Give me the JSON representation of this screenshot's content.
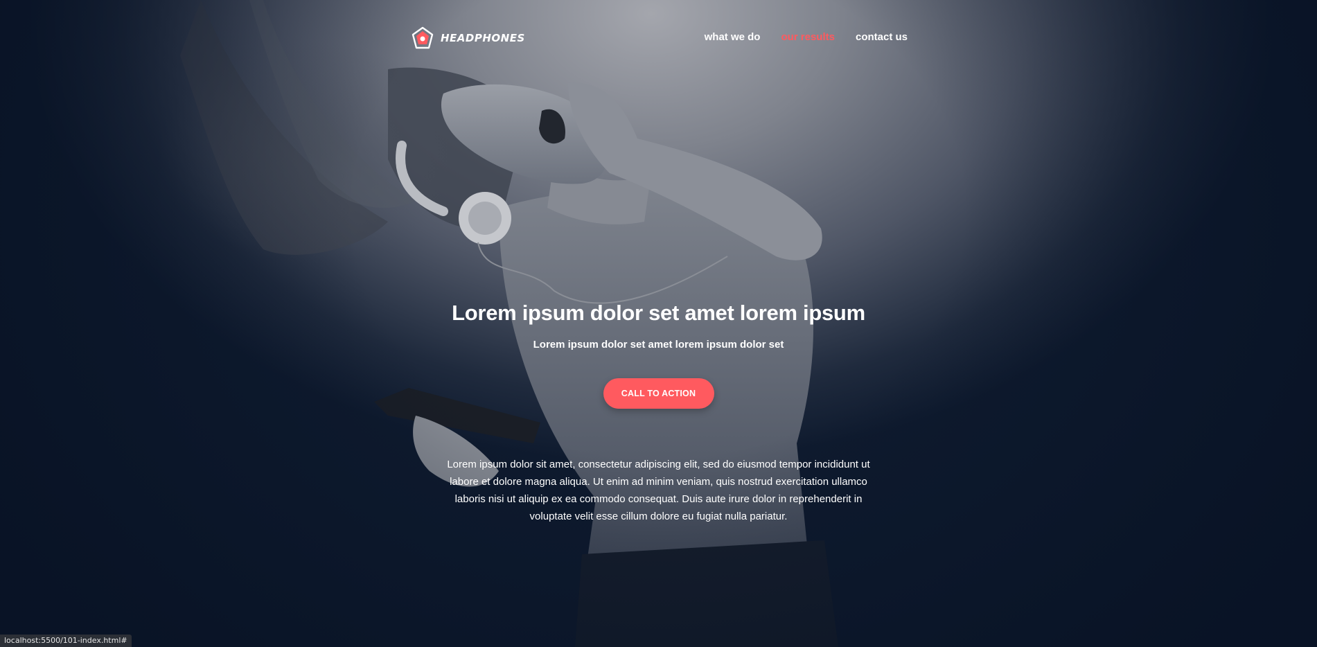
{
  "brand": {
    "name": "HEADPHONES",
    "logo_icon": "pentagon-logo-icon",
    "accent_color": "#ff5a5f"
  },
  "nav": {
    "items": [
      {
        "label": "what we do",
        "active": false
      },
      {
        "label": "our results",
        "active": true
      },
      {
        "label": "contact us",
        "active": false
      }
    ]
  },
  "hero": {
    "title": "Lorem ipsum dolor set amet lorem ipsum",
    "subtitle": "Lorem ipsum dolor set amet lorem ipsum dolor set",
    "cta_label": "CALL TO ACTION",
    "body": "Lorem ipsum dolor sit amet, consectetur adipiscing elit, sed do eiusmod tempor incididunt ut labore et dolore magna aliqua. Ut enim ad minim veniam, quis nostrud exercitation ullamco laboris nisi ut aliquip ex ea commodo consequat. Duis aute irure dolor in reprehenderit in voluptate velit esse cillum dolore eu fugiat nulla pariatur."
  },
  "status_bar": {
    "url": "localhost:5500/101-index.html#"
  }
}
